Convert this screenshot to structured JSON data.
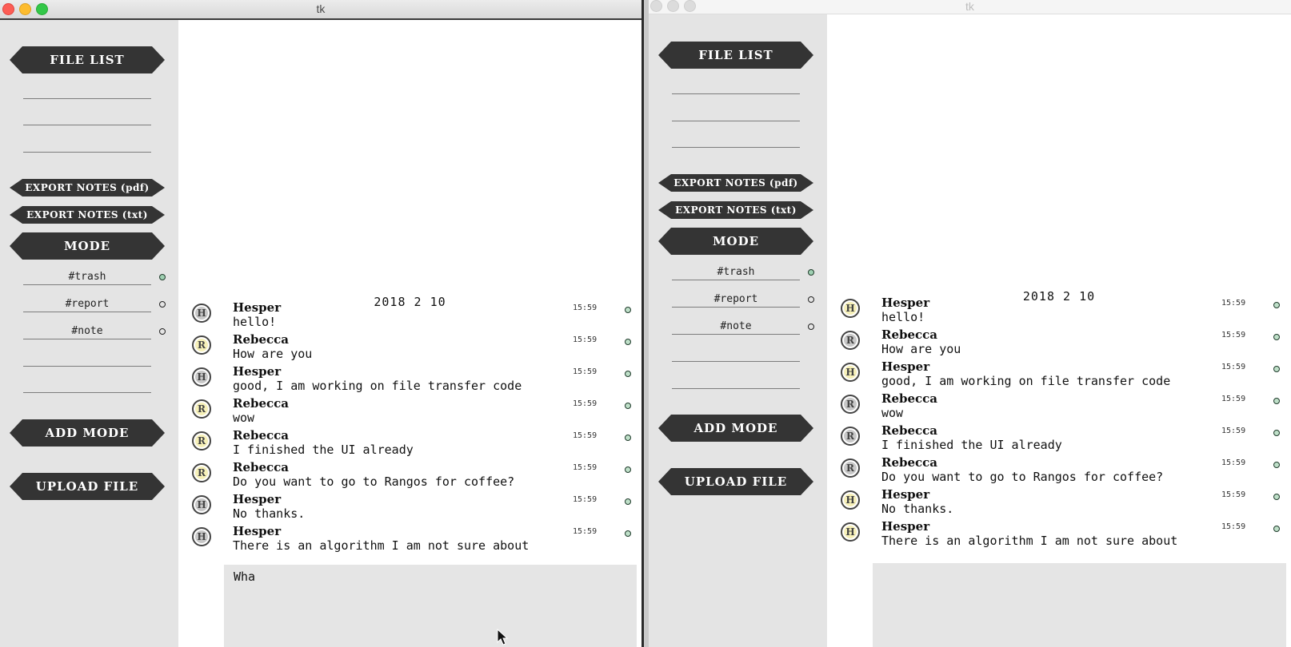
{
  "windows": [
    {
      "title": "tk",
      "sidebar": {
        "file_list": "FILE LIST",
        "export_pdf": "EXPORT NOTES (pdf)",
        "export_txt": "EXPORT NOTES (txt)",
        "mode": "MODE",
        "tags": [
          "#trash",
          "#report",
          "#note"
        ],
        "add_mode": "ADD MODE",
        "upload_file": "UPLOAD FILE"
      },
      "chat": {
        "date": "2018 2 10",
        "messages": [
          {
            "sender": "Hesper",
            "text": "hello!",
            "time": "15:59",
            "avatar": "H"
          },
          {
            "sender": "Rebecca",
            "text": "How are you",
            "time": "15:59",
            "avatar": "R"
          },
          {
            "sender": "Hesper",
            "text": "good, I am working on file transfer code",
            "time": "15:59",
            "avatar": "H"
          },
          {
            "sender": "Rebecca",
            "text": "wow",
            "time": "15:59",
            "avatar": "R"
          },
          {
            "sender": "Rebecca",
            "text": "I finished the UI already",
            "time": "15:59",
            "avatar": "R"
          },
          {
            "sender": "Rebecca",
            "text": "Do you want to go to Rangos for coffee?",
            "time": "15:59",
            "avatar": "R"
          },
          {
            "sender": "Hesper",
            "text": "No thanks.",
            "time": "15:59",
            "avatar": "H"
          },
          {
            "sender": "Hesper",
            "text": "There is an algorithm I am not sure about",
            "time": "15:59",
            "avatar": "H"
          }
        ],
        "input_value": "Wha"
      }
    },
    {
      "title": "tk",
      "sidebar": {
        "file_list": "FILE LIST",
        "export_pdf": "EXPORT NOTES (pdf)",
        "export_txt": "EXPORT NOTES (txt)",
        "mode": "MODE",
        "tags": [
          "#trash",
          "#report",
          "#note"
        ],
        "add_mode": "ADD MODE",
        "upload_file": "UPLOAD FILE"
      },
      "chat": {
        "date": "2018 2 10",
        "messages": [
          {
            "sender": "Hesper",
            "text": "hello!",
            "time": "15:59",
            "avatar": "H"
          },
          {
            "sender": "Rebecca",
            "text": "How are you",
            "time": "15:59",
            "avatar": "R"
          },
          {
            "sender": "Hesper",
            "text": "good, I am working on file transfer code",
            "time": "15:59",
            "avatar": "H"
          },
          {
            "sender": "Rebecca",
            "text": "wow",
            "time": "15:59",
            "avatar": "R"
          },
          {
            "sender": "Rebecca",
            "text": "I finished the UI already",
            "time": "15:59",
            "avatar": "R"
          },
          {
            "sender": "Rebecca",
            "text": "Do you want to go to Rangos for coffee?",
            "time": "15:59",
            "avatar": "R"
          },
          {
            "sender": "Hesper",
            "text": "No thanks.",
            "time": "15:59",
            "avatar": "H"
          },
          {
            "sender": "Hesper",
            "text": "There is an algorithm I am not sure about",
            "time": "15:59",
            "avatar": "H"
          }
        ],
        "input_value": ""
      }
    }
  ],
  "colors": {
    "button_bg": "#343434",
    "sidebar_bg": "#e4e4e4",
    "input_bg": "#e5e5e5",
    "avatar_yellow": "#f6f0b8",
    "avatar_grey": "#c8c8c8",
    "active_dot": "#9fd0b2"
  }
}
